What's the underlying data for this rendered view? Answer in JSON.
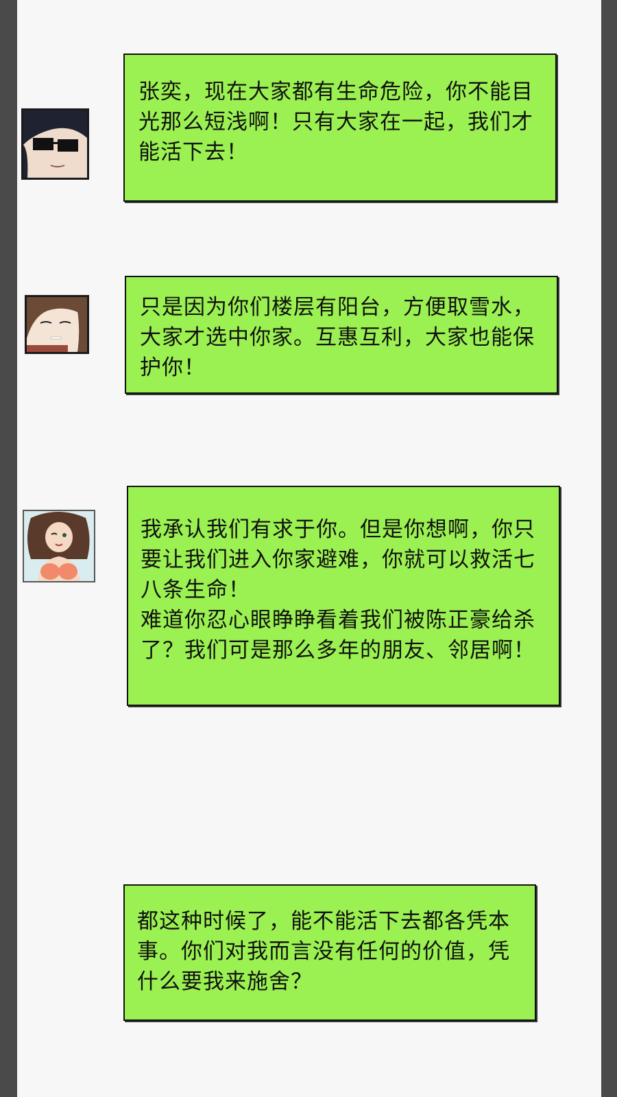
{
  "messages": [
    {
      "avatar": "man-with-sunglasses-avatar",
      "text": "张奕，现在大家都有生命危险，你不能目光那么短浅啊！只有大家在一起，我们才能活下去！"
    },
    {
      "avatar": "woman-with-cigarette-avatar",
      "text": "只是因为你们楼层有阳台，方便取雪水，大家才选中你家。互惠互利，大家也能保护你！"
    },
    {
      "avatar": "woman-in-bikini-avatar",
      "text": "我承认我们有求于你。但是你想啊，你只要让我们进入你家避难，你就可以救活七八条生命！\n难道你忍心眼睁睁看着我们被陈正豪给杀了？我们可是那么多年的朋友、邻居啊！"
    },
    {
      "avatar": null,
      "text": "都这种时候了，能不能活下去都各凭本事。你们对我而言没有任何的价值，凭什么要我来施舍？"
    }
  ],
  "colors": {
    "bubble": "#9bf151",
    "border": "#111111",
    "side_bar": "#4a4a4a",
    "background": "#f7f7f7"
  }
}
